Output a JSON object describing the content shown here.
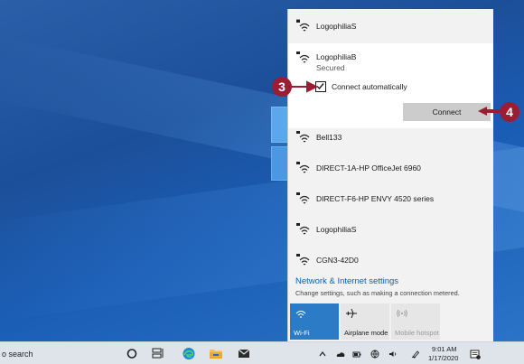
{
  "networks_top": [
    {
      "name": "LogophiliaS",
      "icon": "wifi-secured-icon"
    }
  ],
  "expanded_network": {
    "name": "LogophiliaB",
    "status": "Secured",
    "checkbox_label": "Connect automatically",
    "checkbox_checked": true,
    "connect_label": "Connect"
  },
  "networks_bottom": [
    {
      "name": "Bell133",
      "icon": "wifi-secured-icon"
    },
    {
      "name": "DIRECT-1A-HP OfficeJet 6960",
      "icon": "wifi-secured-icon"
    },
    {
      "name": "DIRECT-F6-HP ENVY 4520 series",
      "icon": "wifi-secured-icon"
    },
    {
      "name": "LogophiliaS",
      "icon": "wifi-secured-icon"
    },
    {
      "name": "CGN3-42D0",
      "icon": "wifi-secured-icon"
    }
  ],
  "settings": {
    "title": "Network & Internet settings",
    "subtitle": "Change settings, such as making a connection metered."
  },
  "tiles": {
    "wifi": "Wi-Fi",
    "airplane": "Airplane mode",
    "hotspot": "Mobile hotspot"
  },
  "callouts": {
    "step3": "3",
    "step4": "4"
  },
  "taskbar": {
    "search_text": "o search",
    "time": "9:01 AM",
    "date": "1/17/2020"
  },
  "colors": {
    "accent": "#2b7bc7",
    "callout": "#9b1d33",
    "link": "#0a5fb0"
  }
}
